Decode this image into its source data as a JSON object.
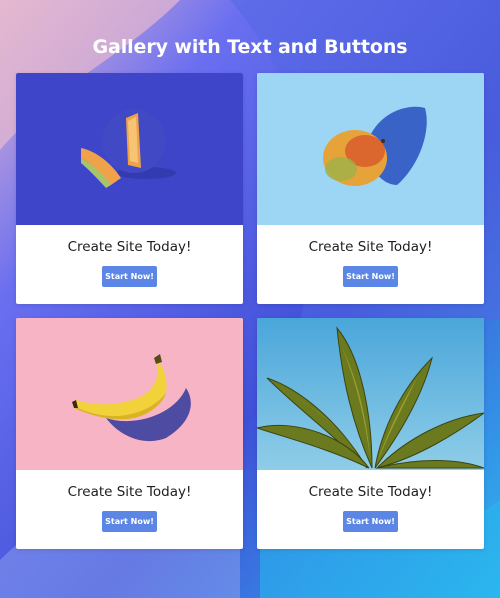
{
  "page": {
    "title": "Gallery with Text and Buttons"
  },
  "colors": {
    "background": "#4a5fe0",
    "button": "#5b86e5",
    "card": "#ffffff"
  },
  "cards": [
    {
      "image": "melon-on-blue",
      "caption": "Create Site Today!",
      "button_label": "Start Now!"
    },
    {
      "image": "mango-on-light-blue",
      "caption": "Create Site Today!",
      "button_label": "Start Now!"
    },
    {
      "image": "banana-on-pink",
      "caption": "Create Site Today!",
      "button_label": "Start Now!"
    },
    {
      "image": "leaves-on-sky",
      "caption": "Create Site Today!",
      "button_label": "Start Now!"
    }
  ]
}
